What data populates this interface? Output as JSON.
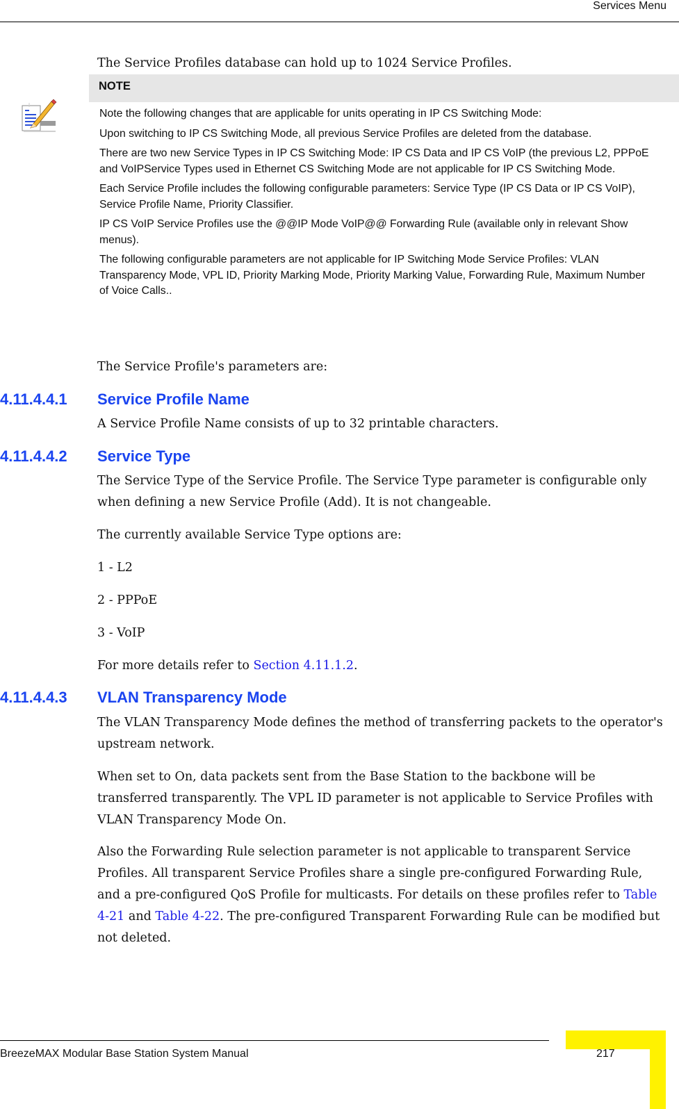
{
  "header": {
    "title": "Services Menu"
  },
  "intro": "The Service Profiles database can hold up to 1024 Service Profiles.",
  "note": {
    "icon": "note-pencil-icon",
    "heading": "NOTE",
    "paragraphs": [
      "Note the following changes that are applicable for units operating in IP CS Switching Mode:",
      "Upon switching to IP CS Switching Mode, all previous Service Profiles are deleted from the database.",
      "There are two new Service Types in IP CS Switching Mode: IP CS Data and IP CS VoIP (the previous L2, PPPoE and VoIPService Types used in Ethernet CS Switching Mode  are not applicable for IP CS Switching Mode.",
      "Each Service Profile includes the following configurable parameters: Service Type (IP CS Data or IP CS VoIP), Service Profile Name, Priority Classifier.",
      "IP CS VoIP Service Profiles use the @@IP Mode VoIP@@ Forwarding Rule (available only in relevant Show menus).",
      "The following configurable parameters are not applicable for IP Switching Mode Service Profiles: VLAN Transparency Mode, VPL ID, Priority Marking Mode, Priority Marking Value, Forwarding Rule, Maximum Number of Voice Calls.."
    ]
  },
  "params_intro": "The Service Profile's parameters are:",
  "sections": [
    {
      "number": "4.11.4.4.1",
      "title": "Service Profile Name",
      "body": "A Service Profile Name consists of up to 32 printable characters."
    },
    {
      "number": "4.11.4.4.2",
      "title": "Service Type",
      "body": "The Service Type of the Service Profile. The Service Type parameter is configurable only when defining a new Service Profile (Add). It is not changeable.",
      "options_intro": "The currently available Service Type options are:",
      "options": [
        "1 - L2",
        "2 - PPPoE",
        "3 - VoIP"
      ],
      "ref_prefix": "For more details refer to ",
      "ref_link": "Section 4.11.1.2",
      "ref_suffix": "."
    },
    {
      "number": "4.11.4.4.3",
      "title": "VLAN Transparency Mode",
      "body": "The VLAN Transparency Mode defines the method of transferring packets to the operator's upstream network.",
      "body2": "When set to On, data packets sent from the Base Station to the backbone will be transferred transparently. The VPL ID parameter is not applicable to Service Profiles with VLAN Transparency Mode On.",
      "body3_a": "Also the Forwarding Rule selection parameter is not applicable to transparent Service Profiles. All transparent Service Profiles share a single pre-configured Forwarding Rule, and a pre-configured QoS Profile for multicasts. For details on these profiles refer to ",
      "body3_link1": "Table 4-21",
      "body3_b": " and ",
      "body3_link2": "Table 4-22",
      "body3_c": ". The pre-configured Transparent Forwarding Rule can be modified but not deleted."
    }
  ],
  "footer": {
    "title": "BreezeMAX Modular Base Station System Manual",
    "page": "217",
    "accent_color": "#fff200"
  },
  "colors": {
    "heading": "#1a44f0",
    "link": "#1a1ae6",
    "note_bg": "#e6e6e6"
  }
}
